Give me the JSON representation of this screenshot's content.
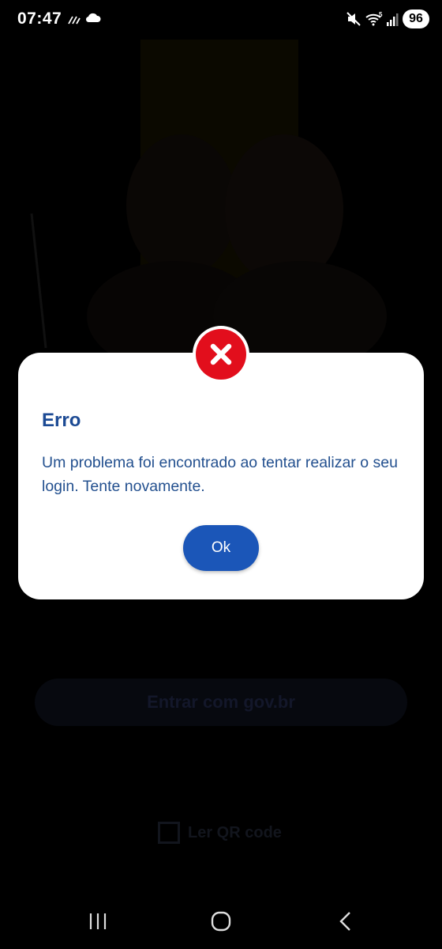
{
  "status_bar": {
    "time": "07:47",
    "battery": "96",
    "icons": [
      "data-saver-icon",
      "cloud-icon",
      "mute-icon",
      "wifi-5g-icon",
      "signal-icon"
    ]
  },
  "background": {
    "login_button_label": "Entrar com gov.br",
    "qr_label": "Ler QR code"
  },
  "dialog": {
    "title": "Erro",
    "message": "Um problema foi encontrado ao tentar realizar o seu login. Tente novamente.",
    "ok_label": "Ok",
    "icon": "error-x-icon",
    "colors": {
      "accent": "#1b56b8",
      "error": "#e20e1c",
      "text": "#1c4a94"
    }
  },
  "nav_bar": {
    "items": [
      "recent-apps-icon",
      "home-icon",
      "back-icon"
    ]
  }
}
